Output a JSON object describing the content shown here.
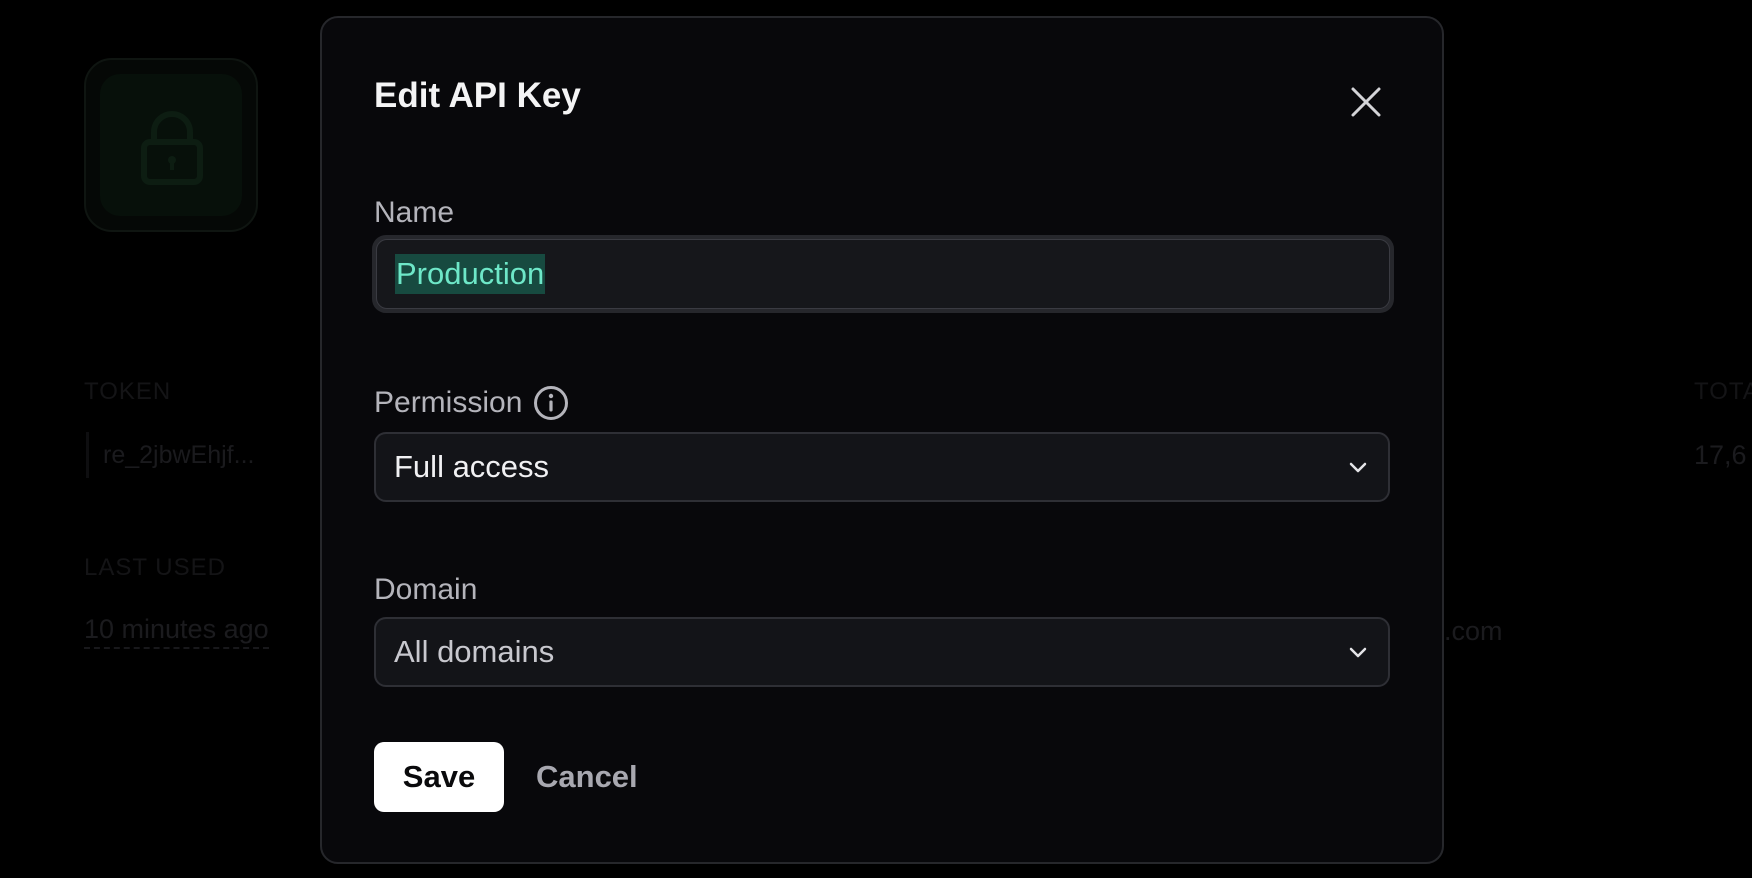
{
  "background": {
    "token_label": "TOKEN",
    "token_value": "re_2jbwEhjf...",
    "last_used_label": "LAST USED",
    "last_used_value": "10 minutes ago",
    "total_label": "TOTA",
    "total_value": "17,6",
    "domain_value_partial": ".com"
  },
  "modal": {
    "title": "Edit API Key",
    "close_icon": "close-icon",
    "name": {
      "label": "Name",
      "value": "Production"
    },
    "permission": {
      "label": "Permission",
      "info_icon": "info-icon",
      "selected": "Full access"
    },
    "domain": {
      "label": "Domain",
      "selected": "All domains"
    },
    "save_label": "Save",
    "cancel_label": "Cancel"
  },
  "colors": {
    "accent_text": "#6ee7c8",
    "selection_bg": "#174a40",
    "modal_bg": "#08080b",
    "primary_button_bg": "#ffffff"
  }
}
